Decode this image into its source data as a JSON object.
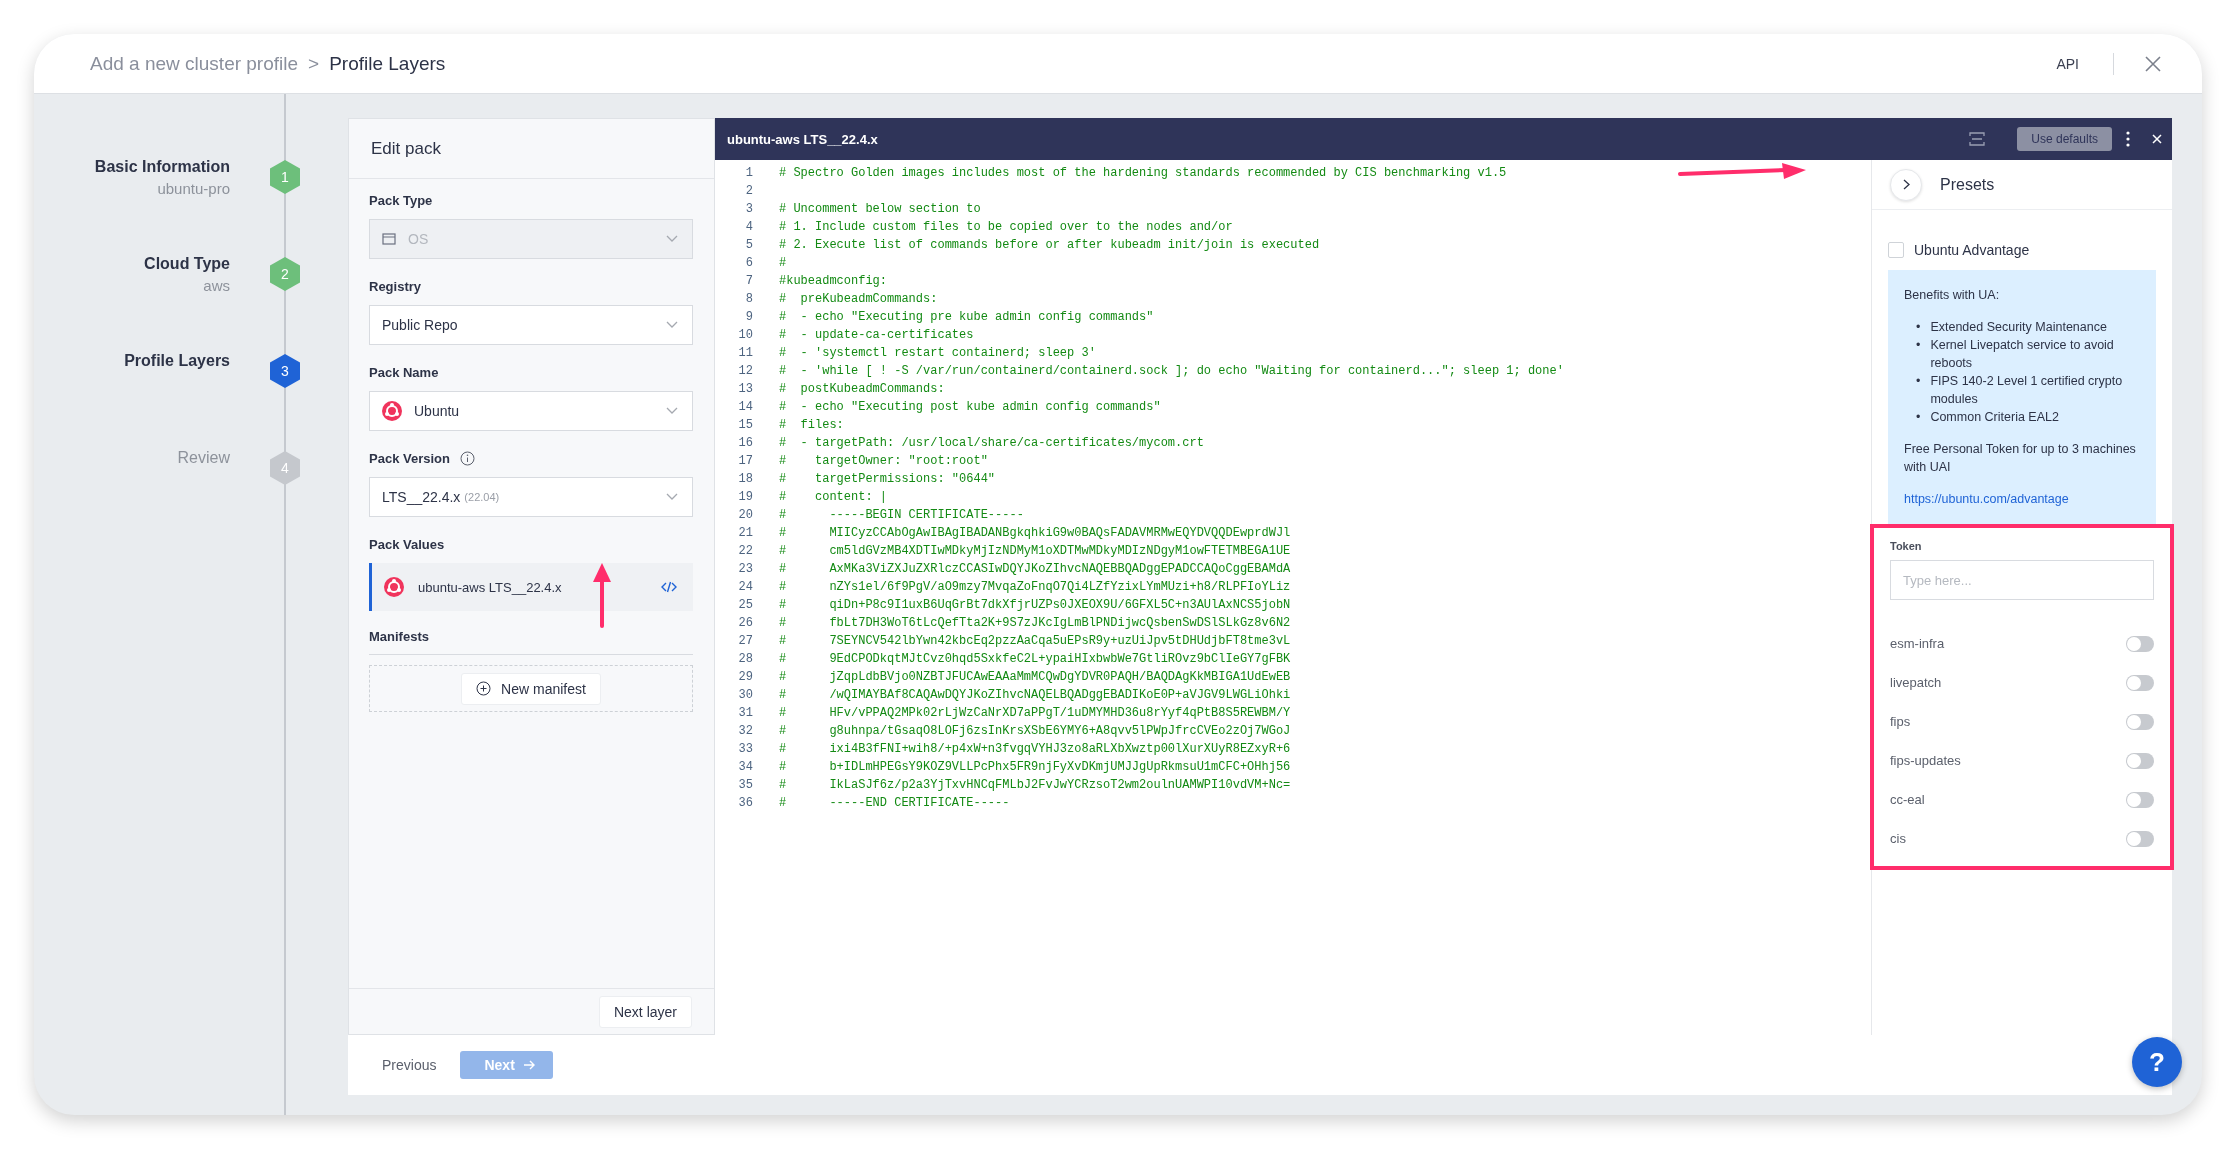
{
  "breadcrumb": {
    "parent": "Add a new cluster profile",
    "separator": ">",
    "current": "Profile Layers"
  },
  "header": {
    "api": "API"
  },
  "steps": [
    {
      "title": "Basic Information",
      "subtitle": "ubuntu-pro",
      "number": "1",
      "completed": true,
      "selected": false
    },
    {
      "title": "Cloud Type",
      "subtitle": "aws",
      "number": "2",
      "completed": true,
      "selected": false
    },
    {
      "title": "Profile Layers",
      "number": "3",
      "completed": false,
      "selected": true
    },
    {
      "title": "Review",
      "number": "4",
      "completed": false,
      "selected": false
    }
  ],
  "edit_pack": {
    "title": "Edit pack",
    "fields": [
      {
        "kind": "ostype",
        "label": "Pack Type",
        "value": "OS",
        "disabled": true,
        "hint_icon": false
      },
      {
        "kind": "plain",
        "label": "Registry",
        "value": "Public Repo",
        "disabled": false,
        "hint_icon": false
      },
      {
        "kind": "pack",
        "label": "Pack Name",
        "value": "Ubuntu",
        "disabled": false,
        "hint_icon": false
      },
      {
        "kind": "plain",
        "label": "Pack Version",
        "value": "LTS__22.4.x",
        "suffix": "(22.04)",
        "disabled": false,
        "hint_icon": true
      }
    ],
    "pack_values": {
      "label": "Pack Values",
      "item": "ubuntu-aws LTS__22.4.x",
      "selected": true
    },
    "manifests": {
      "label": "Manifests",
      "button": "New manifest"
    },
    "next_layer": "Next layer"
  },
  "editor": {
    "title": "ubuntu-aws LTS__22.4.x",
    "use_defaults": "Use defaults",
    "lines": [
      {
        "n": "1",
        "code": "# Spectro Golden images includes most of the hardening standards recommended by CIS benchmarking v1.5"
      },
      {
        "n": "2"
      },
      {
        "n": "3",
        "code": "# Uncomment below section to"
      },
      {
        "n": "4",
        "code": "# 1. Include custom files to be copied over to the nodes and/or"
      },
      {
        "n": "5",
        "code": "# 2. Execute list of commands before or after kubeadm init/join is executed"
      },
      {
        "n": "6",
        "code": "#"
      },
      {
        "n": "7",
        "code": "#kubeadmconfig:"
      },
      {
        "n": "8",
        "code": "#  preKubeadmCommands:"
      },
      {
        "n": "9",
        "code": "#  - echo \"Executing pre kube admin config commands\""
      },
      {
        "n": "10",
        "code": "#  - update-ca-certificates"
      },
      {
        "n": "11",
        "code": "#  - 'systemctl restart containerd; sleep 3'"
      },
      {
        "n": "12",
        "code": "#  - 'while [ ! -S /var/run/containerd/containerd.sock ]; do echo \"Waiting for containerd...\"; sleep 1; done'"
      },
      {
        "n": "13",
        "code": "#  postKubeadmCommands:"
      },
      {
        "n": "14",
        "code": "#  - echo \"Executing post kube admin config commands\""
      },
      {
        "n": "15",
        "code": "#  files:"
      },
      {
        "n": "16",
        "code": "#  - targetPath: /usr/local/share/ca-certificates/mycom.crt"
      },
      {
        "n": "17",
        "code": "#    targetOwner: \"root:root\""
      },
      {
        "n": "18",
        "code": "#    targetPermissions: \"0644\""
      },
      {
        "n": "19",
        "code": "#    content: |"
      },
      {
        "n": "20",
        "code": "#      -----BEGIN CERTIFICATE-----"
      },
      {
        "n": "21",
        "code": "#      MIICyzCCAbOgAwIBAgIBADANBgkqhkiG9w0BAQsFADAVMRMwEQYDVQQDEwprdWJl"
      },
      {
        "n": "22",
        "code": "#      cm5ldGVzMB4XDTIwMDkyMjIzNDMyM1oXDTMwMDkyMDIzNDgyM1owFTETMBEGA1UE"
      },
      {
        "n": "23",
        "code": "#      AxMKa3ViZXJuZXRlczCCASIwDQYJKoZIhvcNAQEBBQADggEPADCCAQoCggEBAMdA"
      },
      {
        "n": "24",
        "code": "#      nZYs1el/6f9PgV/aO9mzy7MvqaZoFnqO7Qi4LZfYzixLYmMUzi+h8/RLPFIoYLiz"
      },
      {
        "n": "25",
        "code": "#      qiDn+P8c9I1uxB6UqGrBt7dkXfjrUZPs0JXEOX9U/6GFXL5C+n3AUlAxNCS5jobN"
      },
      {
        "n": "26",
        "code": "#      fbLt7DH3WoT6tLcQefTta2K+9S7zJKcIgLmBlPNDijwcQsbenSwDSlSLkGz8v6N2"
      },
      {
        "n": "27",
        "code": "#      7SEYNCV542lbYwn42kbcEq2pzzAaCqa5uEPsR9y+uzUiJpv5tDHUdjbFT8tme3vL"
      },
      {
        "n": "28",
        "code": "#      9EdCPODkqtMJtCvz0hqd5SxkfeC2L+ypaiHIxbwbWe7GtliROvz9bClIeGY7gFBK"
      },
      {
        "n": "29",
        "code": "#      jZqpLdbBVjo0NZBTJFUCAwEAAaMmMCQwDgYDVR0PAQH/BAQDAgKkMBIGA1UdEwEB"
      },
      {
        "n": "30",
        "code": "#      /wQIMAYBAf8CAQAwDQYJKoZIhvcNAQELBQADggEBADIKoE0P+aVJGV9LWGLiOhki"
      },
      {
        "n": "31",
        "code": "#      HFv/vPPAQ2MPk02rLjWzCaNrXD7aPPgT/1uDMYMHD36u8rYyf4qPtB8S5REWBM/Y"
      },
      {
        "n": "32",
        "code": "#      g8uhnpa/tGsaqO8LOFj6zsInKrsXSbE6YMY6+A8qvv5lPWpJfrcCVEo2zOj7WGoJ"
      },
      {
        "n": "33",
        "code": "#      ixi4B3fFNI+wih8/+p4xW+n3fvgqVYHJ3zo8aRLXbXwztp00lXurXUyR8EZxyR+6"
      },
      {
        "n": "34",
        "code": "#      b+IDLmHPEGsY9KOZ9VLLPcPhx5FR9njFyXvDKmjUMJJgUpRkmsuU1mCFC+OHhj56"
      },
      {
        "n": "35",
        "code": "#      IkLaSJf6z/p2a3YjTxvHNCqFMLbJ2FvJwYCRzsoT2wm2oulnUAMWPI10vdVM+Nc="
      },
      {
        "n": "36",
        "code": "#      -----END CERTIFICATE-----"
      }
    ]
  },
  "presets": {
    "title": "Presets",
    "ubuntu_advantage": {
      "label": "Ubuntu Advantage",
      "checked": false
    },
    "info": {
      "heading": "Benefits with UA:",
      "bullets": [
        {
          "marker": "•",
          "text": "Extended Security Maintenance"
        },
        {
          "marker": "•",
          "text": "Kernel Livepatch service to avoid reboots"
        },
        {
          "marker": "•",
          "text": "FIPS 140-2 Level 1 certified crypto modules"
        },
        {
          "marker": "•",
          "text": "Common Criteria EAL2"
        }
      ],
      "note": "Free Personal Token for up to 3 machines with UAI",
      "link": "https://ubuntu.com/advantage"
    },
    "token": {
      "label": "Token",
      "placeholder": "Type here..."
    },
    "toggles": [
      {
        "label": "esm-infra",
        "on": false
      },
      {
        "label": "livepatch",
        "on": false
      },
      {
        "label": "fips",
        "on": false
      },
      {
        "label": "fips-updates",
        "on": false
      },
      {
        "label": "cc-eal",
        "on": false
      },
      {
        "label": "cis",
        "on": false
      }
    ]
  },
  "footer": {
    "previous": "Previous",
    "next": "Next",
    "next_disabled": true
  },
  "help": "?"
}
